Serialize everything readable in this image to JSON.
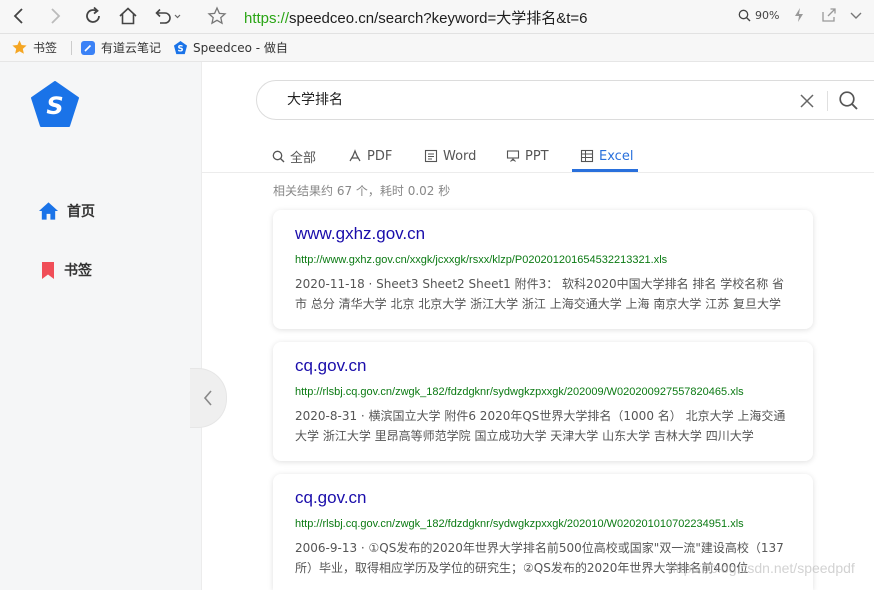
{
  "browser": {
    "url_protocol": "https://",
    "url_rest": "speedceo.cn/search?keyword=大学排名&t=6",
    "zoom": "90%"
  },
  "bookmarks": [
    {
      "label": "书签"
    },
    {
      "label": "有道云笔记"
    },
    {
      "label": "Speedceo - 做自"
    }
  ],
  "sidebar": {
    "items": [
      {
        "label": "首页"
      },
      {
        "label": "书签"
      }
    ]
  },
  "search": {
    "query": "大学排名"
  },
  "tabs": [
    {
      "label": "全部"
    },
    {
      "label": "PDF"
    },
    {
      "label": "Word"
    },
    {
      "label": "PPT"
    },
    {
      "label": "Excel",
      "active": true
    }
  ],
  "results": {
    "stats": "相关结果约 67 个，耗时 0.02 秒",
    "items": [
      {
        "title": "www.gxhz.gov.cn",
        "url": "http://www.gxhz.gov.cn/xxgk/jcxxgk/rsxx/klzp/P020201201654532213321.xls",
        "snippet": "2020-11-18 · Sheet3 Sheet2 Sheet1 附件3： 软科2020中国大学排名 排名 学校名称 省市 总分 清华大学 北京 北京大学 浙江大学 浙江 上海交通大学 上海 南京大学 江苏 复旦大学"
      },
      {
        "title": "cq.gov.cn",
        "url": "http://rlsbj.cq.gov.cn/zwgk_182/fdzdgknr/sydwgkzpxxgk/202009/W020200927557820465.xls",
        "snippet": "2020-8-31 · 横滨国立大学 附件6 2020年QS世界大学排名（1000 名） 北京大学 上海交通大学 浙江大学 里昂高等师范学院 国立成功大学 天津大学 山东大学 吉林大学 四川大学"
      },
      {
        "title": "cq.gov.cn",
        "url": "http://rlsbj.cq.gov.cn/zwgk_182/fdzdgknr/sydwgkzpxxgk/202010/W020201010702234951.xls",
        "snippet": "2006-9-13 · ①QS发布的2020年世界大学排名前500位高校或国家\"双一流\"建设高校（137 所）毕业，取得相应学历及学位的研究生；②QS发布的2020年世界大学排名前400位"
      }
    ]
  },
  "watermark": "https://blog.csdn.net/speedpdf",
  "colors": {
    "link": "#1a0dab",
    "url_green": "#0b7a13",
    "accent": "#2970dc",
    "logo": "#1a73e8"
  }
}
